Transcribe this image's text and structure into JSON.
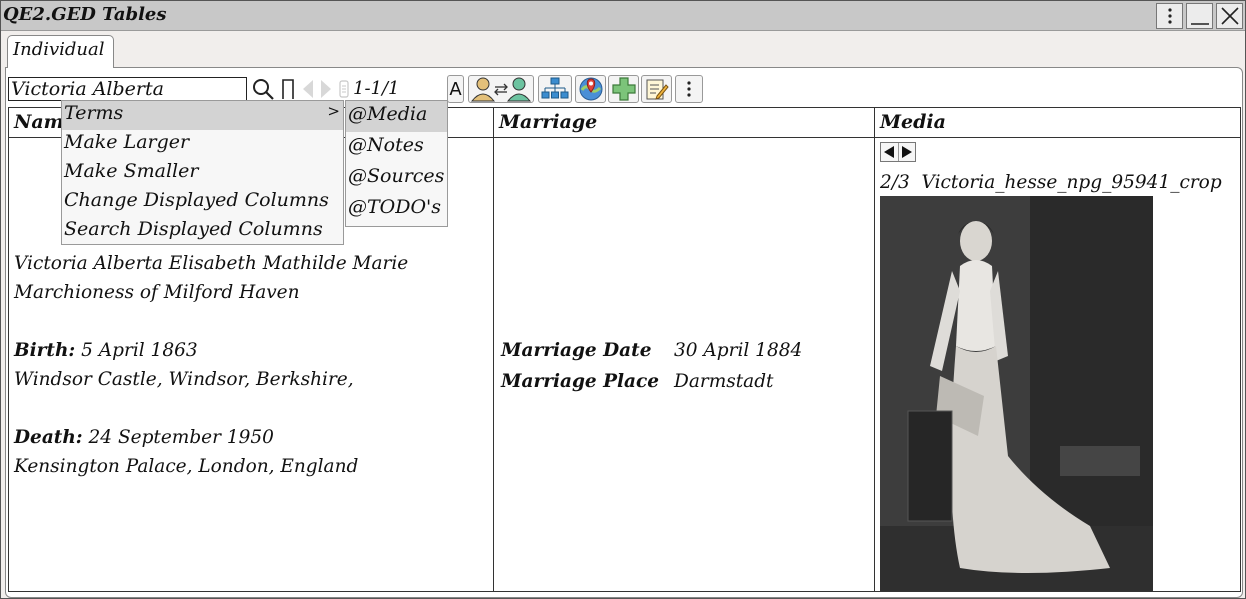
{
  "window": {
    "title": "QE2.GED Tables",
    "more_icon": "vertical-ellipsis-icon",
    "minimize_icon": "minimize-icon",
    "close_icon": "close-icon"
  },
  "tabs": [
    {
      "label": "Individual"
    }
  ],
  "toolbar": {
    "search_value": "Victoria Alberta",
    "result_count": "1-1/1",
    "font_button_label": "A",
    "icons": [
      "search-icon",
      "clear-filter-icon",
      "prev-arrow-icon",
      "next-arrow-icon",
      "scroll-icon",
      "relationship-icon",
      "family-tree-icon",
      "map-pin-icon",
      "add-icon",
      "edit-notes-icon",
      "more-icon"
    ]
  },
  "table": {
    "columns": [
      "Name",
      "Marriage",
      "Media"
    ],
    "name_cell": {
      "full_name_line1": "Victoria Alberta Elisabeth Mathilde Marie",
      "full_name_line2": "Marchioness of Milford Haven",
      "birth_label": "Birth:",
      "birth_date": "5 April 1863",
      "birth_place": "Windsor Castle, Windsor, Berkshire,",
      "death_label": "Death:",
      "death_date": "24 September 1950",
      "death_place": "Kensington Palace, London, England"
    },
    "marriage_cell": {
      "date_label": "Marriage Date",
      "date_value": "30 April 1884",
      "place_label": "Marriage Place",
      "place_value": "Darmstadt"
    },
    "media_cell": {
      "index": "2/3",
      "filename": "Victoria_hesse_npg_95941_crop"
    }
  },
  "context_menu": {
    "items": [
      {
        "label": "Terms",
        "arrow": ">"
      },
      {
        "label": "Make Larger"
      },
      {
        "label": "Make Smaller"
      },
      {
        "label": "Change Displayed Columns"
      },
      {
        "label": "Search Displayed Columns"
      }
    ],
    "submenu": [
      {
        "label": "@Media"
      },
      {
        "label": "@Notes"
      },
      {
        "label": "@Sources"
      },
      {
        "label": "@TODO's"
      }
    ]
  }
}
